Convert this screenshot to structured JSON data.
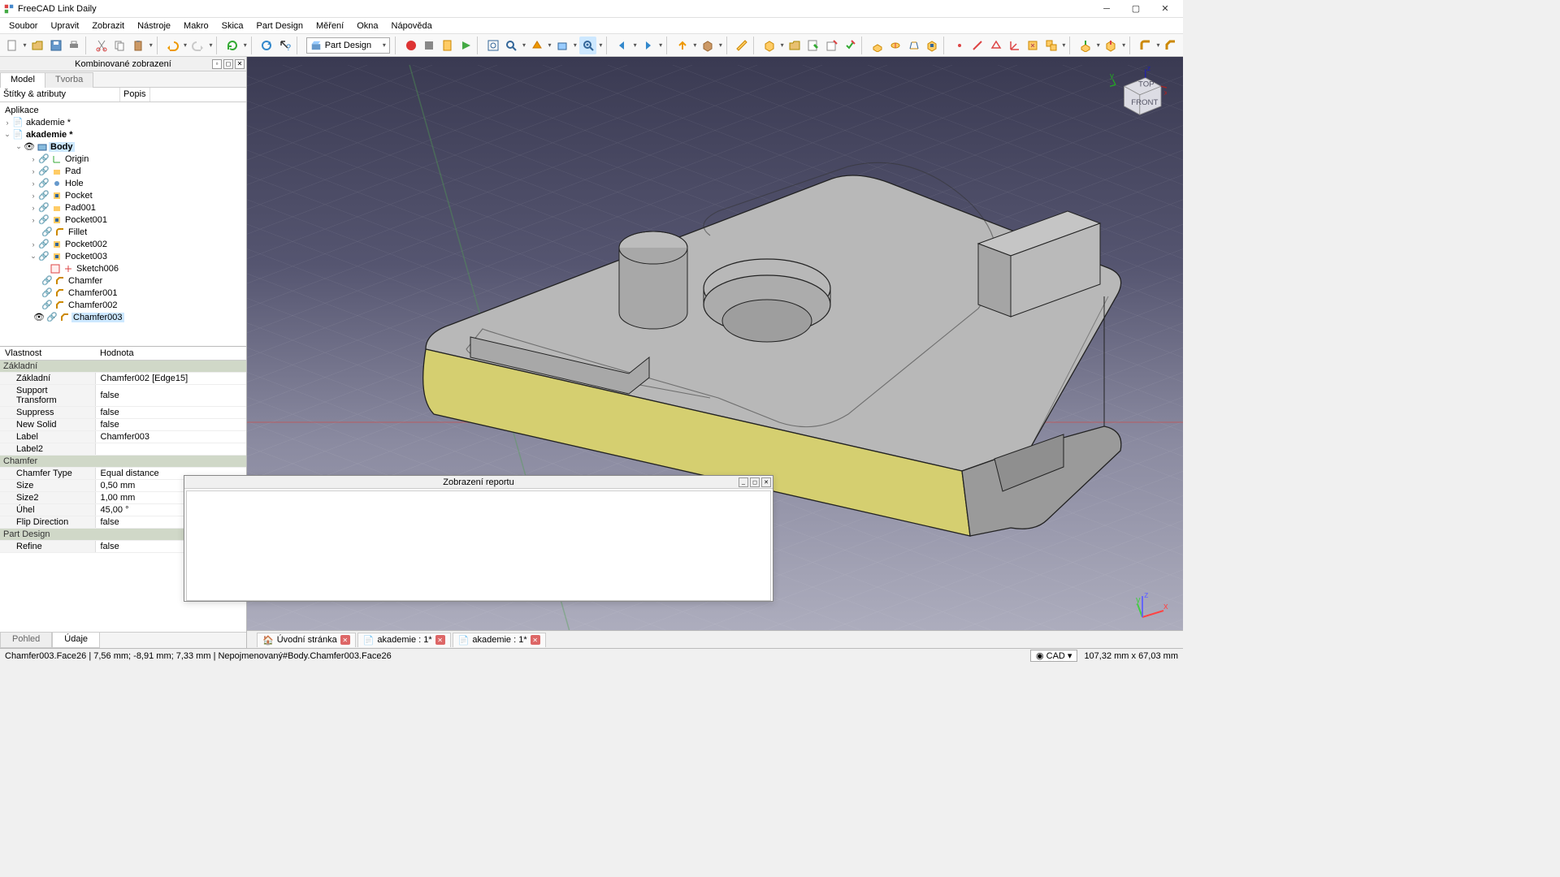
{
  "app_title": "FreeCAD Link Daily",
  "menu": [
    "Soubor",
    "Upravit",
    "Zobrazit",
    "Nástroje",
    "Makro",
    "Skica",
    "Part Design",
    "Měření",
    "Okna",
    "Nápověda"
  ],
  "workbench": "Part Design",
  "combo_panel_title": "Kombinované zobrazení",
  "combo_tabs": [
    "Model",
    "Tvorba"
  ],
  "tree_headers": [
    "Štítky & atributy",
    "Popis"
  ],
  "app_root": "Aplikace",
  "docs": [
    "akademie *",
    "akademie *"
  ],
  "body": "Body",
  "features": [
    "Origin",
    "Pad",
    "Hole",
    "Pocket",
    "Pad001",
    "Pocket001",
    "Fillet",
    "Pocket002",
    "Pocket003"
  ],
  "sketch": "Sketch006",
  "chamfers": [
    "Chamfer",
    "Chamfer001",
    "Chamfer002",
    "Chamfer003"
  ],
  "prop_headers": [
    "Vlastnost",
    "Hodnota"
  ],
  "sec": {
    "zakladni": "Základní",
    "chamfer": "Chamfer",
    "pd": "Part Design"
  },
  "props": {
    "zakladni_k": "Základní",
    "zakladni_v": "Chamfer002 [Edge15]",
    "suptr_k": "Support Transform",
    "suptr_v": "false",
    "suppress_k": "Suppress",
    "suppress_v": "false",
    "newsolid_k": "New Solid",
    "newsolid_v": "false",
    "label_k": "Label",
    "label_v": "Chamfer003",
    "label2_k": "Label2",
    "label2_v": "",
    "chtype_k": "Chamfer Type",
    "chtype_v": "Equal distance",
    "size_k": "Size",
    "size_v": "0,50 mm",
    "size2_k": "Size2",
    "size2_v": "1,00 mm",
    "uhel_k": "Úhel",
    "uhel_v": "45,00 °",
    "flip_k": "Flip Direction",
    "flip_v": "false",
    "refine_k": "Refine",
    "refine_v": "false"
  },
  "bottom_tabs": [
    "Pohled",
    "Údaje"
  ],
  "doc_tabs": [
    "Úvodní stránka",
    "akademie : 1*",
    "akademie : 1*"
  ],
  "report_title": "Zobrazení reportu",
  "status_left": "Chamfer003.Face26 | 7,56 mm;  -8,91 mm; 7,33 mm  | Nepojmenovaný#Body.Chamfer003.Face26",
  "status_cad": "CAD",
  "status_dims": "107,32 mm x 67,03 mm",
  "navcube": {
    "front": "FRONT",
    "top": "TOP"
  }
}
